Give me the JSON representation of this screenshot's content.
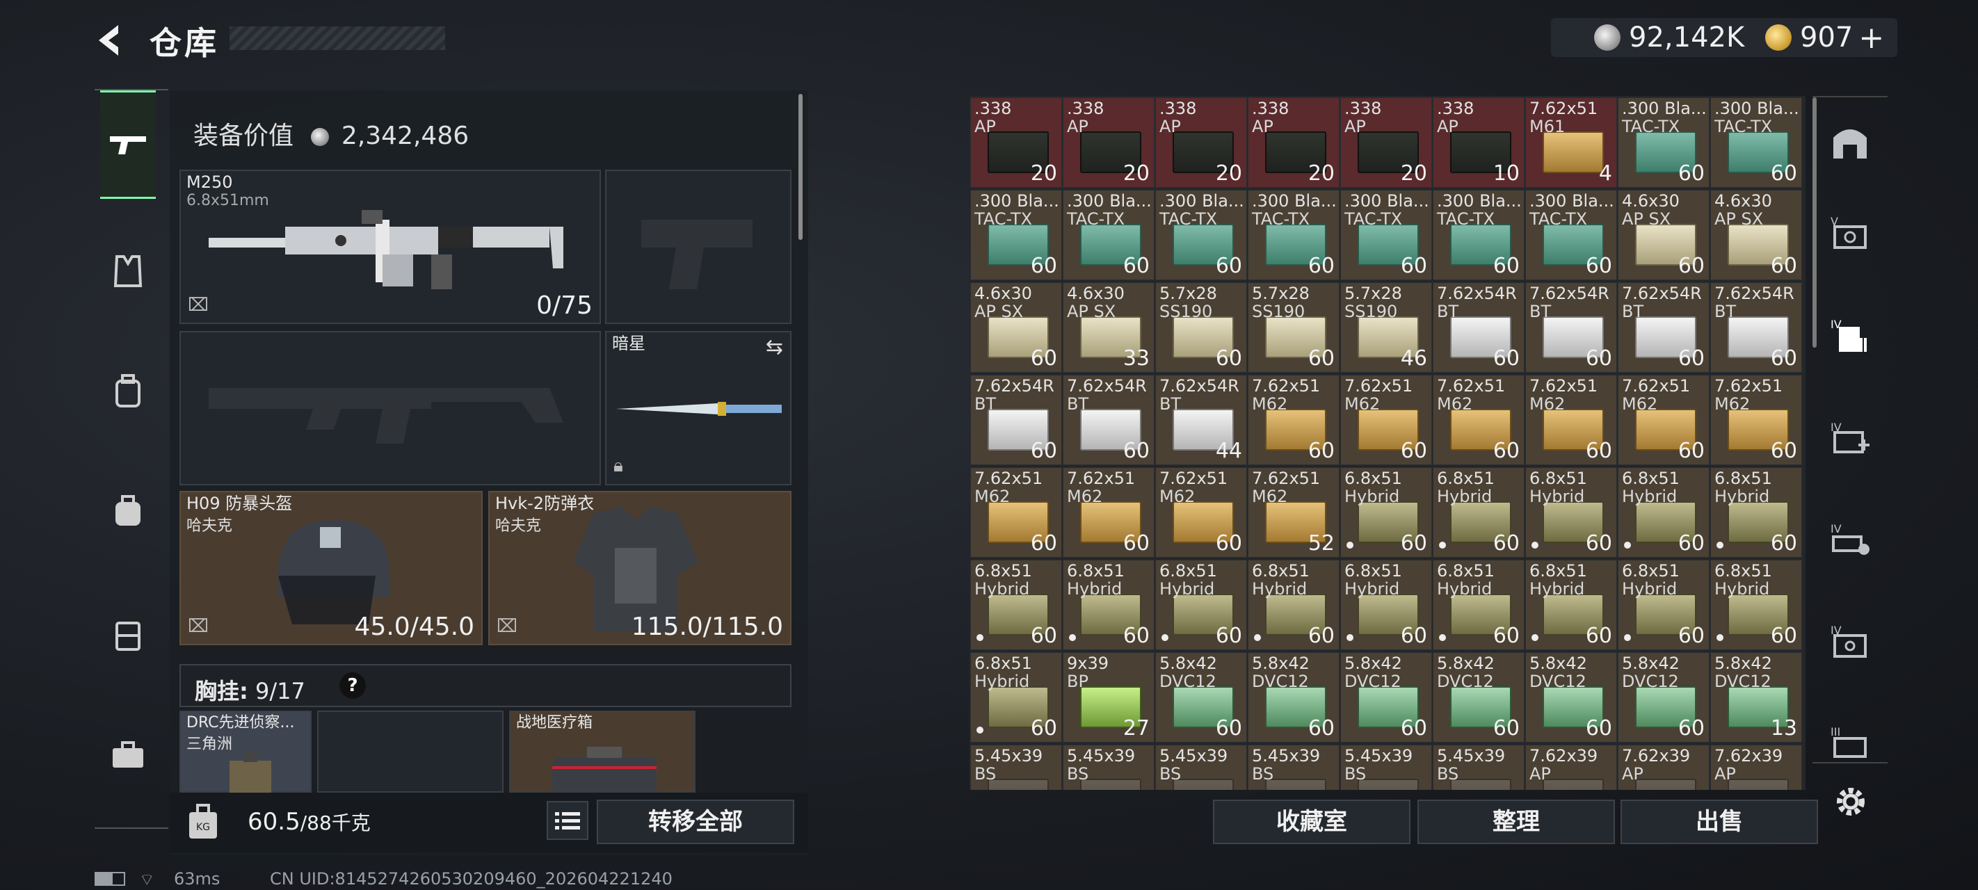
{
  "header": {
    "back_glyph": "<",
    "title": "仓库"
  },
  "currency": {
    "silver": "92,142K",
    "gold": "907",
    "gold_add": "+"
  },
  "nav": {
    "items": [
      "pistol-icon",
      "vest-icon",
      "backpack-alt-icon",
      "backpack-icon",
      "case-icon",
      "toolbox-icon"
    ]
  },
  "loadout": {
    "value_label": "装备价值",
    "value": "2,342,486",
    "primary": {
      "name": "M250",
      "caliber": "6.8x51mm",
      "ammo": "0/75"
    },
    "melee": {
      "name": "暗星"
    },
    "helmet": {
      "name": "H09 防暴头盔",
      "brand": "哈夫克",
      "durability": "45.0/45.0"
    },
    "armor": {
      "name": "Hvk-2防弹衣",
      "brand": "哈夫克",
      "durability": "115.0/115.0"
    },
    "chest_rig": {
      "label": "胸挂:",
      "capacity": "9/17",
      "help": "?"
    },
    "rig_items": [
      {
        "name": "DRC先进侦察...",
        "brand": "三角洲"
      },
      {
        "name": "战地医疗箱"
      }
    ],
    "weight": {
      "value": "60.5",
      "max": "/88千克"
    },
    "transfer_all": "转移全部"
  },
  "stash": {
    "items": [
      {
        "l1": ".338",
        "l2": "AP",
        "q": "20",
        "box": "dark",
        "bg": "red"
      },
      {
        "l1": ".338",
        "l2": "AP",
        "q": "20",
        "box": "dark",
        "bg": "red"
      },
      {
        "l1": ".338",
        "l2": "AP",
        "q": "20",
        "box": "dark",
        "bg": "red"
      },
      {
        "l1": ".338",
        "l2": "AP",
        "q": "20",
        "box": "dark",
        "bg": "red"
      },
      {
        "l1": ".338",
        "l2": "AP",
        "q": "20",
        "box": "dark",
        "bg": "red"
      },
      {
        "l1": ".338",
        "l2": "AP",
        "q": "10",
        "box": "dark",
        "bg": "red"
      },
      {
        "l1": "7.62x51",
        "l2": "M61",
        "q": "4",
        "box": "gold",
        "bg": "red"
      },
      {
        "l1": ".300 Bla...",
        "l2": "TAC-TX",
        "q": "60",
        "box": "green"
      },
      {
        "l1": ".300 Bla...",
        "l2": "TAC-TX",
        "q": "60",
        "box": "green"
      },
      {
        "l1": ".300 Bla...",
        "l2": "TAC-TX",
        "q": "60",
        "box": "green"
      },
      {
        "l1": ".300 Bla...",
        "l2": "TAC-TX",
        "q": "60",
        "box": "green"
      },
      {
        "l1": ".300 Bla...",
        "l2": "TAC-TX",
        "q": "60",
        "box": "green"
      },
      {
        "l1": ".300 Bla...",
        "l2": "TAC-TX",
        "q": "60",
        "box": "green"
      },
      {
        "l1": ".300 Bla...",
        "l2": "TAC-TX",
        "q": "60",
        "box": "green"
      },
      {
        "l1": ".300 Bla...",
        "l2": "TAC-TX",
        "q": "60",
        "box": "green"
      },
      {
        "l1": ".300 Bla...",
        "l2": "TAC-TX",
        "q": "60",
        "box": "green"
      },
      {
        "l1": "4.6x30",
        "l2": "AP SX",
        "q": "60",
        "box": "cream"
      },
      {
        "l1": "4.6x30",
        "l2": "AP SX",
        "q": "60",
        "box": "cream"
      },
      {
        "l1": "4.6x30",
        "l2": "AP SX",
        "q": "60",
        "box": "cream"
      },
      {
        "l1": "4.6x30",
        "l2": "AP SX",
        "q": "33",
        "box": "cream"
      },
      {
        "l1": "5.7x28",
        "l2": "SS190",
        "q": "60",
        "box": "cream"
      },
      {
        "l1": "5.7x28",
        "l2": "SS190",
        "q": "60",
        "box": "cream"
      },
      {
        "l1": "5.7x28",
        "l2": "SS190",
        "q": "46",
        "box": "cream"
      },
      {
        "l1": "7.62x54R",
        "l2": "BT",
        "q": "60",
        "box": "white"
      },
      {
        "l1": "7.62x54R",
        "l2": "BT",
        "q": "60",
        "box": "white"
      },
      {
        "l1": "7.62x54R",
        "l2": "BT",
        "q": "60",
        "box": "white"
      },
      {
        "l1": "7.62x54R",
        "l2": "BT",
        "q": "60",
        "box": "white"
      },
      {
        "l1": "7.62x54R",
        "l2": "BT",
        "q": "60",
        "box": "white"
      },
      {
        "l1": "7.62x54R",
        "l2": "BT",
        "q": "60",
        "box": "white"
      },
      {
        "l1": "7.62x54R",
        "l2": "BT",
        "q": "44",
        "box": "white"
      },
      {
        "l1": "7.62x51",
        "l2": "M62",
        "q": "60",
        "box": "gold"
      },
      {
        "l1": "7.62x51",
        "l2": "M62",
        "q": "60",
        "box": "gold"
      },
      {
        "l1": "7.62x51",
        "l2": "M62",
        "q": "60",
        "box": "gold"
      },
      {
        "l1": "7.62x51",
        "l2": "M62",
        "q": "60",
        "box": "gold"
      },
      {
        "l1": "7.62x51",
        "l2": "M62",
        "q": "60",
        "box": "gold"
      },
      {
        "l1": "7.62x51",
        "l2": "M62",
        "q": "60",
        "box": "gold"
      },
      {
        "l1": "7.62x51",
        "l2": "M62",
        "q": "60",
        "box": "gold"
      },
      {
        "l1": "7.62x51",
        "l2": "M62",
        "q": "60",
        "box": "gold"
      },
      {
        "l1": "7.62x51",
        "l2": "M62",
        "q": "60",
        "box": "gold"
      },
      {
        "l1": "7.62x51",
        "l2": "M62",
        "q": "52",
        "box": "gold"
      },
      {
        "l1": "6.8x51",
        "l2": "Hybrid",
        "q": "60",
        "box": "olive",
        "dot": true
      },
      {
        "l1": "6.8x51",
        "l2": "Hybrid",
        "q": "60",
        "box": "olive",
        "dot": true
      },
      {
        "l1": "6.8x51",
        "l2": "Hybrid",
        "q": "60",
        "box": "olive",
        "dot": true
      },
      {
        "l1": "6.8x51",
        "l2": "Hybrid",
        "q": "60",
        "box": "olive",
        "dot": true
      },
      {
        "l1": "6.8x51",
        "l2": "Hybrid",
        "q": "60",
        "box": "olive",
        "dot": true
      },
      {
        "l1": "6.8x51",
        "l2": "Hybrid",
        "q": "60",
        "box": "olive",
        "dot": true
      },
      {
        "l1": "6.8x51",
        "l2": "Hybrid",
        "q": "60",
        "box": "olive",
        "dot": true
      },
      {
        "l1": "6.8x51",
        "l2": "Hybrid",
        "q": "60",
        "box": "olive",
        "dot": true
      },
      {
        "l1": "6.8x51",
        "l2": "Hybrid",
        "q": "60",
        "box": "olive",
        "dot": true
      },
      {
        "l1": "6.8x51",
        "l2": "Hybrid",
        "q": "60",
        "box": "olive",
        "dot": true
      },
      {
        "l1": "6.8x51",
        "l2": "Hybrid",
        "q": "60",
        "box": "olive",
        "dot": true
      },
      {
        "l1": "6.8x51",
        "l2": "Hybrid",
        "q": "60",
        "box": "olive",
        "dot": true
      },
      {
        "l1": "6.8x51",
        "l2": "Hybrid",
        "q": "60",
        "box": "olive",
        "dot": true
      },
      {
        "l1": "6.8x51",
        "l2": "Hybrid",
        "q": "60",
        "box": "olive",
        "dot": true
      },
      {
        "l1": "6.8x51",
        "l2": "Hybrid",
        "q": "60",
        "box": "olive",
        "dot": true
      },
      {
        "l1": "9x39",
        "l2": "BP",
        "q": "27",
        "box": "lime"
      },
      {
        "l1": "5.8x42",
        "l2": "DVC12",
        "q": "60",
        "box": "mint"
      },
      {
        "l1": "5.8x42",
        "l2": "DVC12",
        "q": "60",
        "box": "mint"
      },
      {
        "l1": "5.8x42",
        "l2": "DVC12",
        "q": "60",
        "box": "mint"
      },
      {
        "l1": "5.8x42",
        "l2": "DVC12",
        "q": "60",
        "box": "mint"
      },
      {
        "l1": "5.8x42",
        "l2": "DVC12",
        "q": "60",
        "box": "mint"
      },
      {
        "l1": "5.8x42",
        "l2": "DVC12",
        "q": "60",
        "box": "mint"
      },
      {
        "l1": "5.8x42",
        "l2": "DVC12",
        "q": "13",
        "box": "mint"
      },
      {
        "l1": "5.45x39",
        "l2": "BS",
        "q": "",
        "box": "grey"
      },
      {
        "l1": "5.45x39",
        "l2": "BS",
        "q": "",
        "box": "grey"
      },
      {
        "l1": "5.45x39",
        "l2": "BS",
        "q": "",
        "box": "grey"
      },
      {
        "l1": "5.45x39",
        "l2": "BS",
        "q": "",
        "box": "grey"
      },
      {
        "l1": "5.45x39",
        "l2": "BS",
        "q": "",
        "box": "grey"
      },
      {
        "l1": "5.45x39",
        "l2": "BS",
        "q": "",
        "box": "grey"
      },
      {
        "l1": "7.62x39",
        "l2": "AP",
        "q": "",
        "box": "grey"
      },
      {
        "l1": "7.62x39",
        "l2": "AP",
        "q": "",
        "box": "grey"
      },
      {
        "l1": "7.62x39",
        "l2": "AP",
        "q": "",
        "box": "grey"
      }
    ],
    "collection": "收藏室",
    "sort": "整理",
    "sell": "出售"
  },
  "side_tabs": [
    "armory-icon",
    "stash-v-icon",
    "stash-iv-icon",
    "stash-iv-medical-icon",
    "stash-iv-key-icon",
    "stash-iv-case-icon",
    "stash-iii-icon"
  ],
  "status": {
    "ping": "63ms",
    "uid": "CN UID:8145274260530209460_202604221240"
  }
}
